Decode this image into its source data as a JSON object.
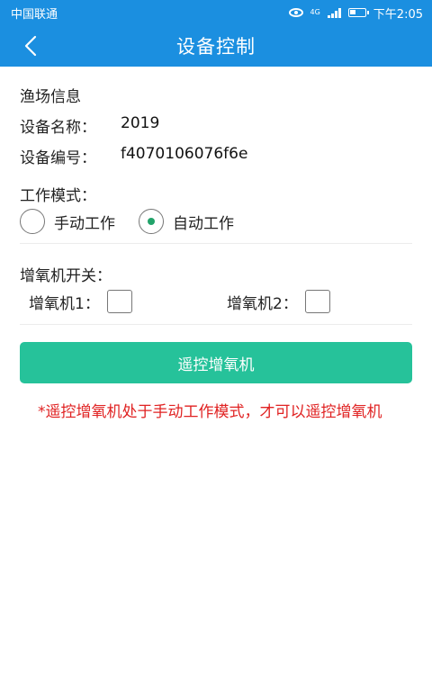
{
  "status_bar": {
    "carrier": "中国联通",
    "network": "4G",
    "time": "下午2:05"
  },
  "header": {
    "title": "设备控制",
    "back_icon": "chevron-left-icon"
  },
  "fishery": {
    "section_title": "渔场信息",
    "device_name_label": "设备名称：",
    "device_name": "2019",
    "device_id_label": "设备编号：",
    "device_id": "f4070106076f6e"
  },
  "work_mode": {
    "section_title": "工作模式：",
    "options": [
      {
        "label": "手动工作",
        "selected": false
      },
      {
        "label": "自动工作",
        "selected": true
      }
    ]
  },
  "aerator_switch": {
    "section_title": "增氧机开关：",
    "items": [
      {
        "label": "增氧机1：",
        "checked": false
      },
      {
        "label": "增氧机2：",
        "checked": false
      }
    ]
  },
  "remote_button": {
    "label": "遥控增氧机"
  },
  "notice": "*遥控增氧机处于手动工作模式，才可以遥控增氧机",
  "colors": {
    "header": "#1b8fe0",
    "button": "#26c29a",
    "notice": "#e02222",
    "radio_dot": "#22a36a"
  }
}
